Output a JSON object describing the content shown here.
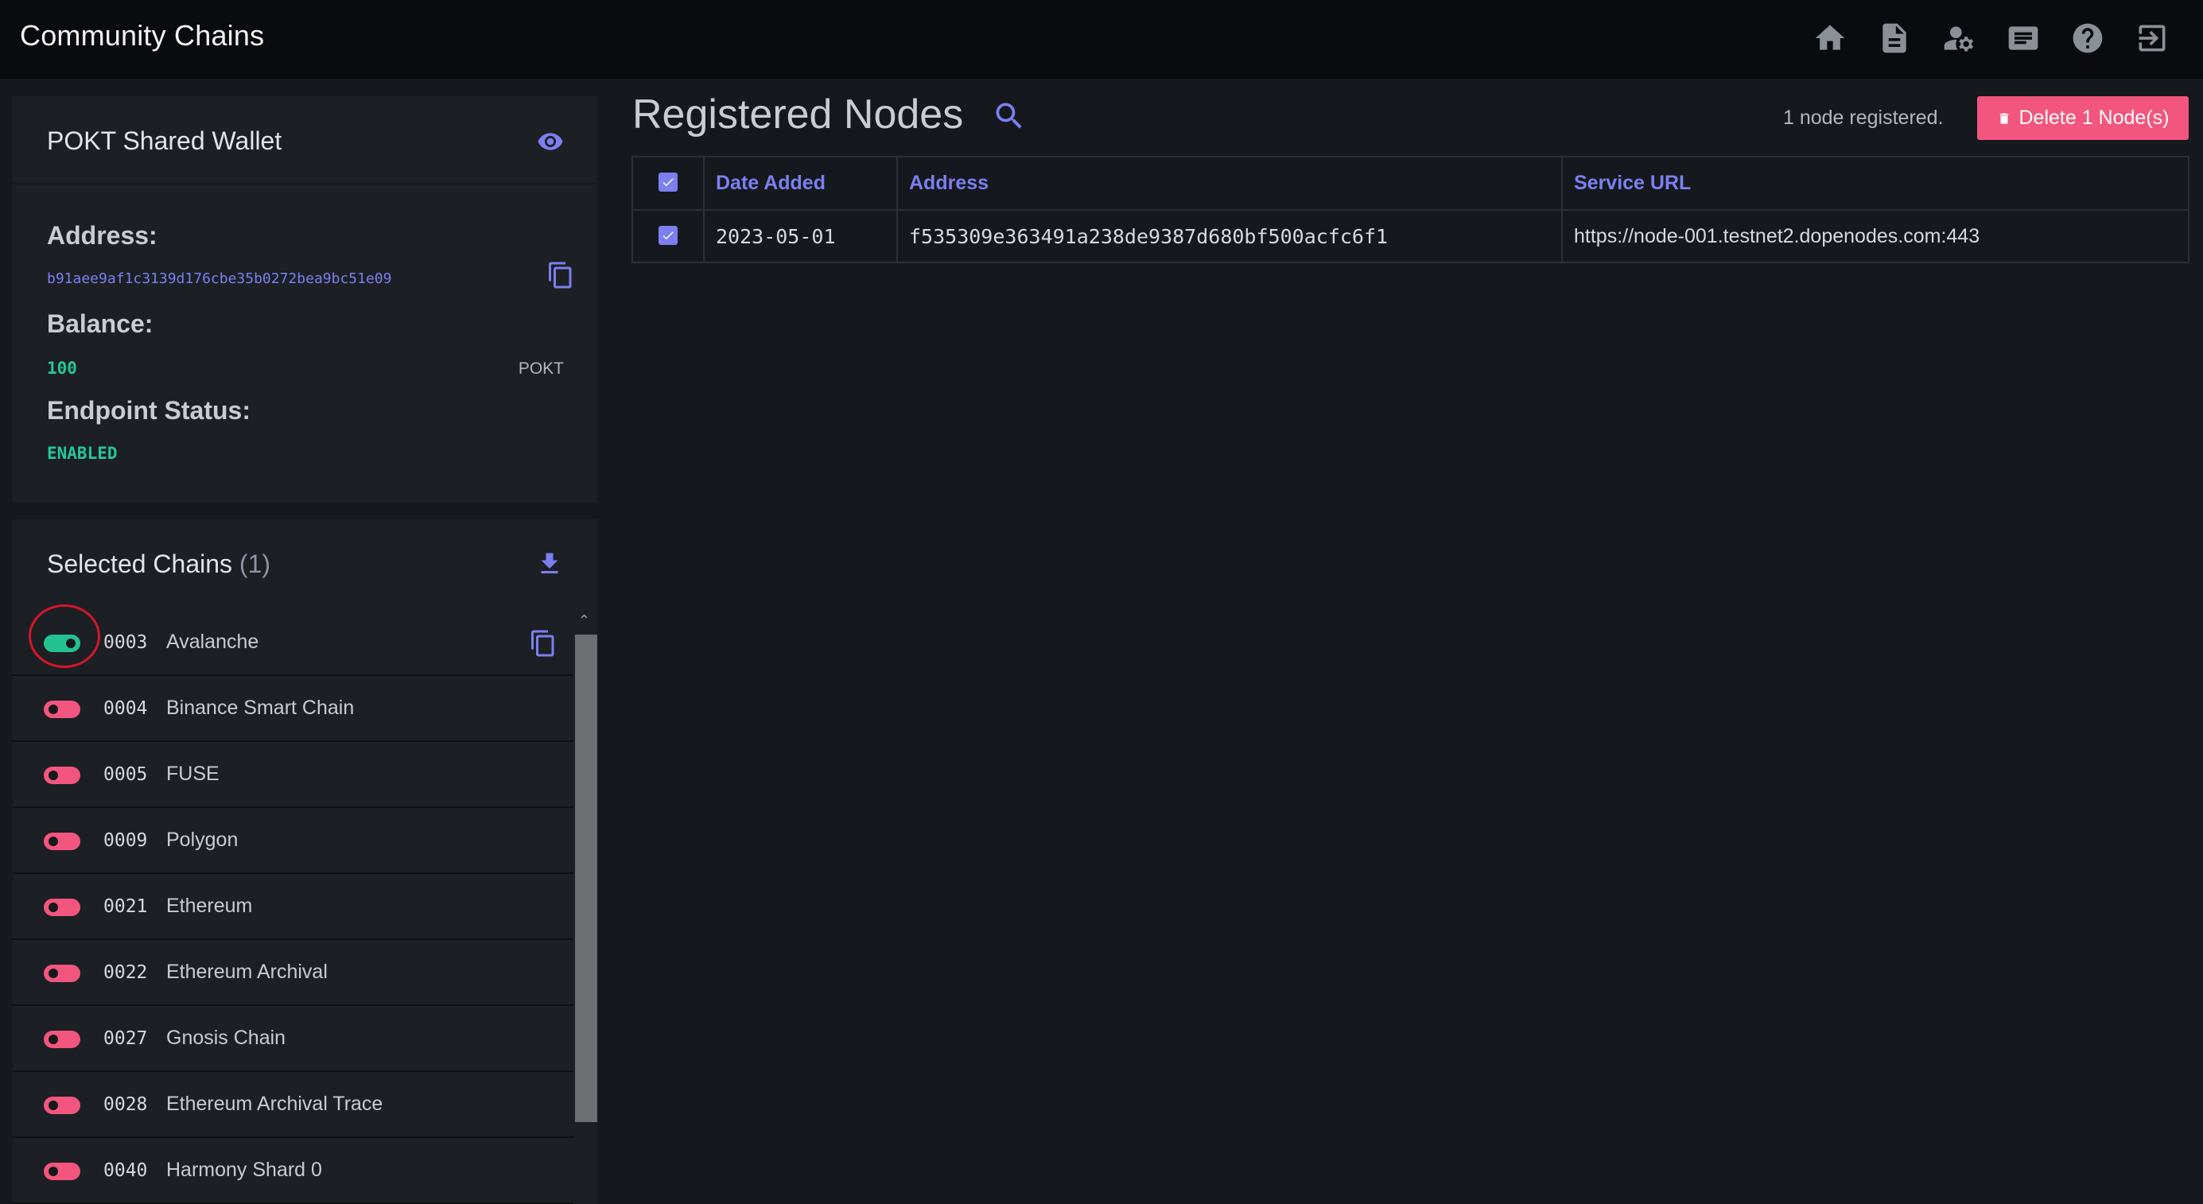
{
  "app": {
    "title": "Community Chains"
  },
  "nav": {
    "icons": [
      "home-icon",
      "document-icon",
      "user-settings-icon",
      "notes-icon",
      "help-icon",
      "logout-icon"
    ]
  },
  "wallet": {
    "title": "POKT Shared Wallet",
    "address_label": "Address:",
    "address": "b91aee9af1c3139d176cbe35b0272bea9bc51e09",
    "balance_label": "Balance:",
    "balance": "100",
    "balance_unit": "POKT",
    "endpoint_label": "Endpoint Status:",
    "endpoint_status": "ENABLED"
  },
  "chains": {
    "title": "Selected Chains",
    "count": "(1)",
    "items": [
      {
        "id": "0003",
        "name": "Avalanche",
        "enabled": true
      },
      {
        "id": "0004",
        "name": "Binance Smart Chain",
        "enabled": false
      },
      {
        "id": "0005",
        "name": "FUSE",
        "enabled": false
      },
      {
        "id": "0009",
        "name": "Polygon",
        "enabled": false
      },
      {
        "id": "0021",
        "name": "Ethereum",
        "enabled": false
      },
      {
        "id": "0022",
        "name": "Ethereum Archival",
        "enabled": false
      },
      {
        "id": "0027",
        "name": "Gnosis Chain",
        "enabled": false
      },
      {
        "id": "0028",
        "name": "Ethereum Archival Trace",
        "enabled": false
      },
      {
        "id": "0040",
        "name": "Harmony Shard 0",
        "enabled": false
      }
    ]
  },
  "main": {
    "title": "Registered Nodes",
    "node_count": "1 node registered.",
    "delete_label": "Delete 1 Node(s)",
    "table": {
      "headers": [
        "Date Added",
        "Address",
        "Service URL"
      ],
      "rows": [
        {
          "date": "2023-05-01",
          "address": "f535309e363491a238de9387d680bf500acfc6f1",
          "url": "https://node-001.testnet2.dopenodes.com:443",
          "checked": true
        }
      ]
    }
  },
  "colors": {
    "accent": "#7c7ff0",
    "success": "#25c79a",
    "danger": "#f2557d",
    "topbar": "#0a0b0c",
    "panel": "#1c1f24",
    "background": "#15181d"
  }
}
